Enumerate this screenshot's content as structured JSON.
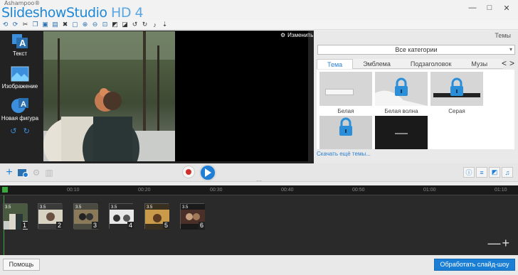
{
  "window": {
    "brand": "Ashampoo®",
    "title_main": "SlideshowStudio",
    "title_suffix": "HD 4",
    "controls": [
      "—",
      "□",
      "✕"
    ]
  },
  "colors": {
    "accent": "#1f7fd6",
    "dark_panel": "#222222",
    "timeline_bg": "#2a2a2a",
    "link": "#2a7fd0"
  },
  "left_panel": {
    "items": [
      {
        "label": "Текст",
        "icon": "text-icon"
      },
      {
        "label": "Изображение",
        "icon": "image-icon"
      },
      {
        "label": "Новая фигура",
        "icon": "shape-icon"
      }
    ]
  },
  "preview": {
    "change_label": "Изменить"
  },
  "themes": {
    "header": "Темы",
    "category": "Все категории",
    "tabs": [
      "Тема",
      "Эмблема",
      "Подзаголовок",
      "Музы"
    ],
    "cards": [
      {
        "label": "Белая",
        "locked": false
      },
      {
        "label": "Белая волна",
        "locked": true
      },
      {
        "label": "Серая",
        "locked": true
      },
      {
        "label": "",
        "locked": true
      },
      {
        "label": "",
        "locked": false
      }
    ],
    "more_link": "Скачать ещё темы..."
  },
  "timeline": {
    "ticks": [
      "00:10",
      "00:20",
      "00:30",
      "00:40",
      "00:50",
      "01:00",
      "01:10"
    ],
    "clips": [
      {
        "num": "1",
        "duration": "3.5"
      },
      {
        "num": "2",
        "duration": "3.5"
      },
      {
        "num": "3",
        "duration": "3.5"
      },
      {
        "num": "4",
        "duration": "3.5"
      },
      {
        "num": "5",
        "duration": "3.5"
      },
      {
        "num": "6",
        "duration": "3.5"
      }
    ],
    "zoom": "—+"
  },
  "footer": {
    "help_label": "Помощь",
    "process_label": "Обработать слайд-шоу"
  }
}
